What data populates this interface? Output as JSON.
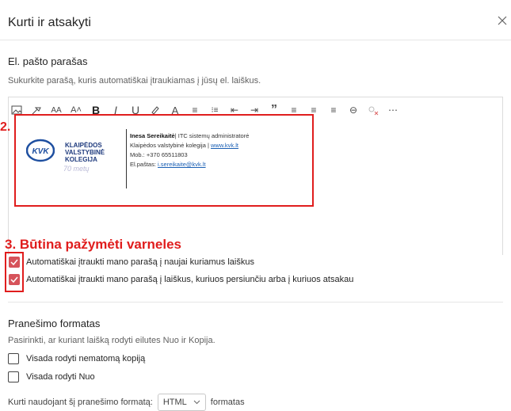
{
  "dialog": {
    "title": "Kurti ir atsakyti"
  },
  "signature_section": {
    "title": "El. pašto parašas",
    "description": "Sukurkite parašą, kuris automatiškai įtraukiamas į jūsų el. laiškus."
  },
  "toolbar": {
    "items": [
      {
        "name": "insert-picture-icon",
        "glyph": ""
      },
      {
        "name": "format-painter-icon",
        "glyph": ""
      },
      {
        "name": "font-size-icon",
        "glyph": "AA"
      },
      {
        "name": "grow-font-icon",
        "glyph": "A˄"
      },
      {
        "name": "bold-icon",
        "glyph": "B"
      },
      {
        "name": "italic-icon",
        "glyph": "I"
      },
      {
        "name": "underline-icon",
        "glyph": "U"
      },
      {
        "name": "highlight-icon",
        "glyph": ""
      },
      {
        "name": "font-color-icon",
        "glyph": "A"
      },
      {
        "name": "bullets-icon",
        "glyph": "≡"
      },
      {
        "name": "numbering-icon",
        "glyph": "⁝≡"
      },
      {
        "name": "decrease-indent-icon",
        "glyph": "⇤"
      },
      {
        "name": "increase-indent-icon",
        "glyph": "⇥"
      },
      {
        "name": "quote-icon",
        "glyph": "”"
      },
      {
        "name": "align-left-icon",
        "glyph": "≡"
      },
      {
        "name": "align-center-icon",
        "glyph": "≡"
      },
      {
        "name": "align-right-icon",
        "glyph": "≡"
      },
      {
        "name": "link-icon",
        "glyph": "⊖"
      },
      {
        "name": "unlink-icon",
        "glyph": ""
      },
      {
        "name": "more-icon",
        "glyph": "⋯"
      }
    ]
  },
  "annotations": {
    "sig_number": "2.",
    "must_check": "3. Būtina pažymėti varneles"
  },
  "signature": {
    "logo_text": [
      "KLAIPĖDOS",
      "VALSTYBINĖ",
      "KOLEGIJA"
    ],
    "logo_mark": "KVK",
    "logo_script": "70 metų",
    "name": "Inesa Sereikaitė",
    "role": "| ITC sistemų administratorė",
    "org": "Klaipėdos valstybinė kolegija | ",
    "org_link": "www.kvk.lt",
    "phone": "Mob.: +370 65511803",
    "email_label": "El.paštas: ",
    "email_link": "i.sereikaite@kvk.lt"
  },
  "checkboxes": {
    "auto_new": {
      "label": "Automatiškai įtraukti mano parašą į naujai kuriamus laiškus",
      "checked": true
    },
    "auto_reply": {
      "label": "Automatiškai įtraukti mano parašą į laiškus, kuriuos persiunčiu arba į kuriuos atsakau",
      "checked": true
    },
    "always_bcc": {
      "label": "Visada rodyti nematomą kopiją",
      "checked": false
    },
    "always_from": {
      "label": "Visada rodyti Nuo",
      "checked": false
    }
  },
  "message_format": {
    "title": "Pranešimo formatas",
    "description": "Pasirinkti, ar kuriant laišką rodyti eilutes Nuo ir Kopija.",
    "compose_prefix": "Kurti naudojant šį pranešimo formatą:",
    "compose_value": "HTML",
    "compose_suffix": "formatas"
  },
  "colors": {
    "accent_check": "#d6535a",
    "annotation_red": "#e01d1d",
    "link": "#1a5fb4"
  }
}
